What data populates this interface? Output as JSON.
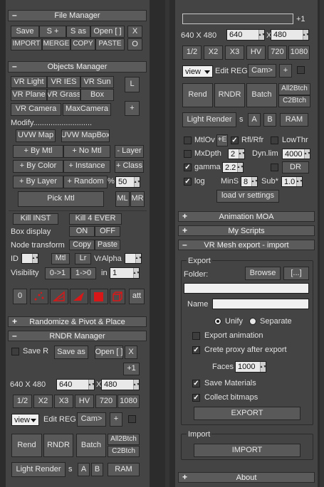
{
  "left": {
    "file_manager": {
      "title": "File Manager",
      "row1": [
        "Save",
        "S +",
        "S as",
        "Open [ ]",
        "X"
      ],
      "row2": [
        "IMPORT",
        "MERGE",
        "COPY",
        "PASTE",
        "O"
      ]
    },
    "objects_manager": {
      "title": "Objects Manager",
      "vr_row1": [
        "VR Light",
        "VR IES",
        "VR Sun"
      ],
      "vr_row2": [
        "VR Plane",
        "VR Grass",
        "Box"
      ],
      "l_button": "L",
      "camera_row": [
        "VR Camera",
        "MaxCamera"
      ],
      "plus_button": "+",
      "modify_label": "Modify...........................",
      "uvw": [
        "UVW Map",
        "UVW MapBox"
      ],
      "by_mtl": "+ By Mtl",
      "no_mtl": "+ No Mtl",
      "layer_minus": "- Layer",
      "by_color": "+ By Color",
      "instance": "+ Instance",
      "class_plus": "+ Class",
      "by_layer": "+ By Layer",
      "random": "+ Random",
      "percent": "%",
      "percent_value": "50",
      "pick_mtl": "Pick Mtl",
      "ml": "ML",
      "mr": "MR",
      "kill_inst": "Kill INST",
      "kill_4ever": "Kill 4 EVER",
      "box_display_label": "Box display",
      "on": "ON",
      "off": "OFF",
      "node_transform_label": "Node transform",
      "copy": "Copy",
      "paste": "Paste",
      "id_label": "ID",
      "mtl": "Mtl",
      "lr": "Lr",
      "vralpha": "VrAlpha",
      "visibility_label": "Visibility",
      "zero_to_one": "0->1",
      "one_to_zero": "1->0",
      "in_label": "in",
      "in_value": "1",
      "icons_zero": "0",
      "att": "att"
    },
    "randomize": {
      "title": "Randomize & Pivot & Place",
      "sign": "+"
    },
    "rndr_manager": {
      "title": "RNDR Manager",
      "save_r": "Save R",
      "save_as": "Save as",
      "open": "Open [ ]",
      "x": "X",
      "plus1": "+1",
      "res_label": "640 X 480",
      "width": "640",
      "height": "480",
      "presets": [
        "1/2",
        "X2",
        "X3",
        "HV",
        "720",
        "1080"
      ],
      "view": "view",
      "edit_reg": "Edit REG",
      "cam": "Cam>",
      "plus": "+",
      "rend": "Rend",
      "rndr": "RNDR",
      "batch": "Batch",
      "all2btch": "All2Btch",
      "c2btch": "C2Btch",
      "light_render": "Light Render",
      "s": "s",
      "a": "A",
      "b": "B",
      "ram": "RAM"
    }
  },
  "right": {
    "plus1": "+1",
    "res_label": "640 X 480",
    "width": "640",
    "height": "480",
    "presets": [
      "1/2",
      "X2",
      "X3",
      "HV",
      "720",
      "1080"
    ],
    "view": "view",
    "edit_reg": "Edit REG",
    "cam": "Cam>",
    "plus": "+",
    "rend": "Rend",
    "rndr": "RNDR",
    "batch": "Batch",
    "all2btch": "All2Btch",
    "c2btch": "C2Btch",
    "light_render": "Light Render",
    "s": "s",
    "a": "A",
    "b": "B",
    "ram": "RAM",
    "mtlov": "MtlOv",
    "plus_e": "+E",
    "rfl_rfr": "Rfl/Rfr",
    "lowthr": "LowThr",
    "mxdpth": "MxDpth",
    "mxdpth_value": "2",
    "dyn_lim": "Dyn.lim",
    "dyn_lim_value": "4000",
    "gamma": "gamma",
    "gamma_value": "2.2",
    "dr": "DR",
    "log": "log",
    "mins": "MinS",
    "mins_value": "8",
    "sub": "Sub*",
    "sub_value": "1.0",
    "load_vr_settings": "load vr settings",
    "animation_moa": "Animation MOA",
    "my_scripts": "My Scripts",
    "vr_mesh": "VR Mesh export - import",
    "export_group": "Export",
    "folder_label": "Folder:",
    "browse": "Browse",
    "dots": "[...]",
    "name_label": "Name",
    "unify": "Unify",
    "separate": "Separate",
    "export_animation": "Export animation",
    "crete_proxy": "Crete proxy after export",
    "faces_label": "Faces",
    "faces_value": "1000",
    "save_materials": "Save Materials",
    "collect_bitmaps": "Collect bitmaps",
    "export_btn": "EXPORT",
    "import_group": "Import",
    "import_btn": "IMPORT",
    "about": "About"
  },
  "colors": {
    "icon_red": "#d81818",
    "panel_bg": "#444444"
  }
}
